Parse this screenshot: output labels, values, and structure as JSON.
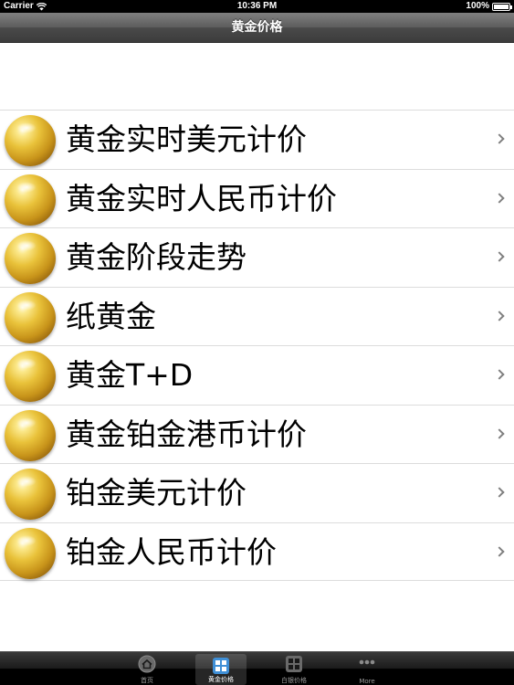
{
  "status_bar": {
    "carrier": "Carrier",
    "time": "10:36 PM",
    "battery_percent": "100%",
    "battery_level": 1.0,
    "wifi_icon": "wifi-icon"
  },
  "nav_bar": {
    "title": "黄金价格"
  },
  "list": {
    "item_icon": "gold-ball-icon",
    "accessory_icon": "chevron-right-icon",
    "items": [
      {
        "label": "黄金实时美元计价"
      },
      {
        "label": "黄金实时人民币计价"
      },
      {
        "label": "黄金阶段走势"
      },
      {
        "label": "纸黄金"
      },
      {
        "label": "黄金T+D"
      },
      {
        "label": "黄金铂金港币计价"
      },
      {
        "label": "铂金美元计价"
      },
      {
        "label": "铂金人民币计价"
      }
    ]
  },
  "tab_bar": {
    "active_index": 1,
    "tabs": [
      {
        "label": "首页",
        "icon": "home-icon"
      },
      {
        "label": "黄金价格",
        "icon": "grid-icon"
      },
      {
        "label": "白银价格",
        "icon": "grid-icon"
      },
      {
        "label": "More",
        "icon": "more-icon"
      }
    ]
  }
}
